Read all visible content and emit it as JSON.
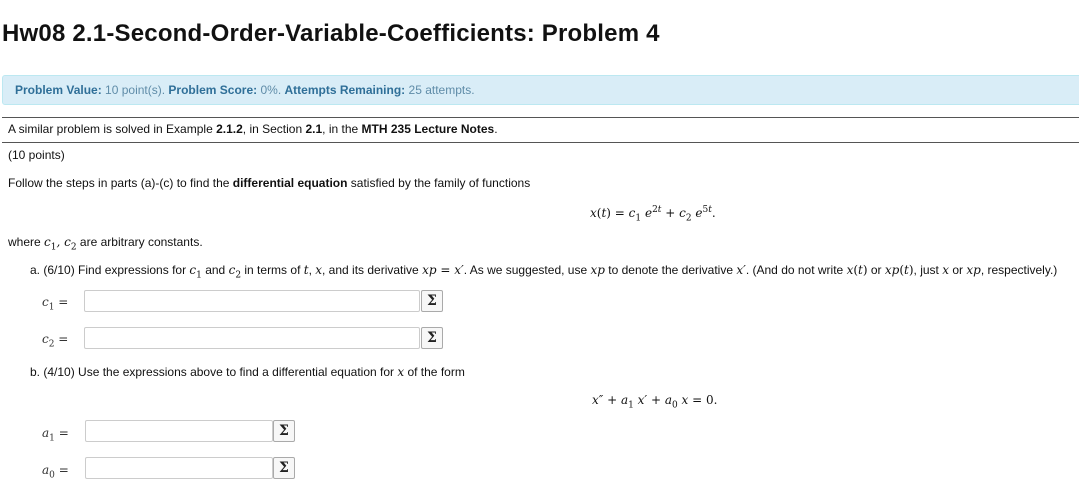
{
  "page_title": "Hw08 2.1-Second-Order-Variable-Coefficients: Problem 4",
  "info_bar": {
    "value_label": "Problem Value:",
    "value_text": "10 point(s).",
    "score_label": "Problem Score:",
    "score_text": "0%.",
    "attempts_label": "Attempts Remaining:",
    "attempts_text": "25 attempts."
  },
  "intro": {
    "prefix": "A similar problem is solved in Example ",
    "example": "2.1.2",
    "mid": ", in Section ",
    "section": "2.1",
    "mid2": ", in the ",
    "notes": "MTH 235 Lecture Notes",
    "suffix": "."
  },
  "points": "(10 points)",
  "instructions": {
    "prefix": "Follow the steps in parts (a)-(c) to find the ",
    "bold": "differential equation",
    "suffix": " satisfied by the family of functions"
  },
  "where_line": {
    "prefix": "where ",
    "suffix": " are arbitrary constants."
  },
  "part_a": {
    "label": "a. (6/10) Find expressions for ",
    "t1": " and ",
    "t2": " in terms of ",
    "t3": ", and its derivative ",
    "t4": ". As we suggested, use ",
    "t5": " to denote the derivative ",
    "t6": ". (And do not write ",
    "t7": " or ",
    "t8": ", just ",
    "t9": " or ",
    "t10": ", respectively.)"
  },
  "part_b": {
    "label": "b. (4/10) Use the expressions above to find a differential equation for ",
    "suffix": " of the form"
  },
  "fields": {
    "c1": {
      "value": "",
      "placeholder": ""
    },
    "c2": {
      "value": "",
      "placeholder": ""
    },
    "a1": {
      "value": "",
      "placeholder": ""
    },
    "a0": {
      "value": "",
      "placeholder": ""
    }
  },
  "equation_button_symbol": "Σ",
  "icons": {
    "equation": "sigma-icon"
  },
  "colors": {
    "info_bg": "#d9edf7",
    "info_text": "#3a87ad"
  }
}
